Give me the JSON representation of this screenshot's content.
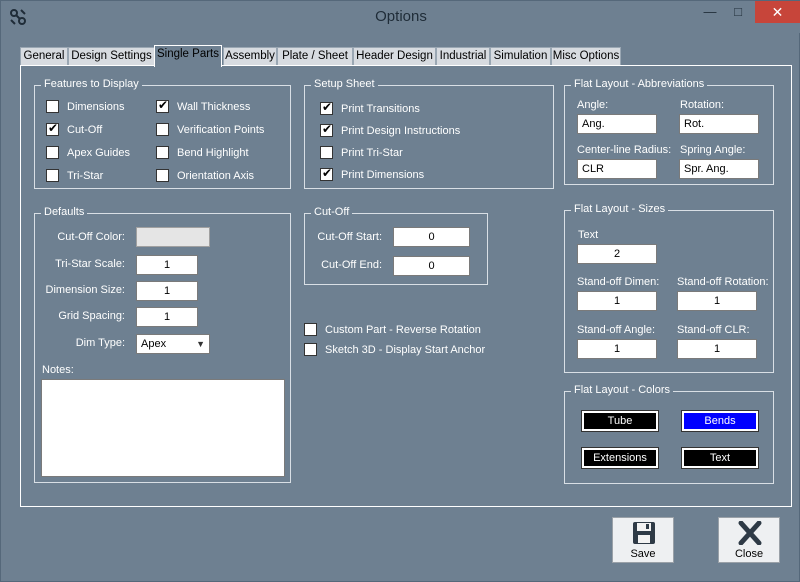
{
  "window": {
    "title": "Options"
  },
  "titlebar_buttons": {
    "minimize": "—",
    "maximize": "□",
    "close": "✕"
  },
  "tabs": [
    "General",
    "Design Settings",
    "Single Parts",
    "Assembly",
    "Plate / Sheet",
    "Header Design",
    "Industrial",
    "Simulation",
    "Misc Options"
  ],
  "active_tab": "Single Parts",
  "features": {
    "title": "Features to Display",
    "items": [
      {
        "label": "Dimensions",
        "checked": false
      },
      {
        "label": "Wall Thickness",
        "checked": true
      },
      {
        "label": "Cut-Off",
        "checked": true
      },
      {
        "label": "Verification Points",
        "checked": false
      },
      {
        "label": "Apex Guides",
        "checked": false
      },
      {
        "label": "Bend Highlight",
        "checked": false
      },
      {
        "label": "Tri-Star",
        "checked": false
      },
      {
        "label": "Orientation Axis",
        "checked": false
      }
    ]
  },
  "setup_sheet": {
    "title": "Setup Sheet",
    "items": [
      {
        "label": "Print Transitions",
        "checked": true
      },
      {
        "label": "Print Design Instructions",
        "checked": true
      },
      {
        "label": "Print Tri-Star",
        "checked": false
      },
      {
        "label": "Print Dimensions",
        "checked": true
      }
    ]
  },
  "defaults": {
    "title": "Defaults",
    "cutoff_color_label": "Cut-Off Color:",
    "tristar_scale_label": "Tri-Star Scale:",
    "tristar_scale": "1",
    "dimension_size_label": "Dimension Size:",
    "dimension_size": "1",
    "grid_spacing_label": "Grid Spacing:",
    "grid_spacing": "1",
    "dim_type_label": "Dim Type:",
    "dim_type": "Apex",
    "notes_label": "Notes:",
    "notes": ""
  },
  "cutoff": {
    "title": "Cut-Off",
    "start_label": "Cut-Off Start:",
    "start": "0",
    "end_label": "Cut-Off End:",
    "end": "0"
  },
  "misc_checks": [
    {
      "label": "Custom Part - Reverse Rotation",
      "checked": false
    },
    {
      "label": "Sketch 3D - Display Start Anchor",
      "checked": false
    }
  ],
  "abbreviations": {
    "title": "Flat Layout - Abbreviations",
    "angle_label": "Angle:",
    "angle": "Ang.",
    "rotation_label": "Rotation:",
    "rotation": "Rot.",
    "clr_label": "Center-line Radius:",
    "clr": "CLR",
    "spring_label": "Spring Angle:",
    "spring": "Spr. Ang."
  },
  "sizes": {
    "title": "Flat Layout - Sizes",
    "text_label": "Text",
    "text": "2",
    "standoff_dimen_label": "Stand-off Dimen:",
    "standoff_dimen": "1",
    "standoff_rotation_label": "Stand-off Rotation:",
    "standoff_rotation": "1",
    "standoff_angle_label": "Stand-off  Angle:",
    "standoff_angle": "1",
    "standoff_clr_label": "Stand-off  CLR:",
    "standoff_clr": "1"
  },
  "colors": {
    "title": "Flat Layout - Colors",
    "buttons": [
      {
        "label": "Tube",
        "bg": "#000000"
      },
      {
        "label": "Bends",
        "bg": "#0000ff"
      },
      {
        "label": "Extensions",
        "bg": "#000000"
      },
      {
        "label": "Text",
        "bg": "#000000"
      }
    ],
    "cutoff_swatch": "#e5e5e5"
  },
  "actions": {
    "save": "Save",
    "close": "Close"
  }
}
